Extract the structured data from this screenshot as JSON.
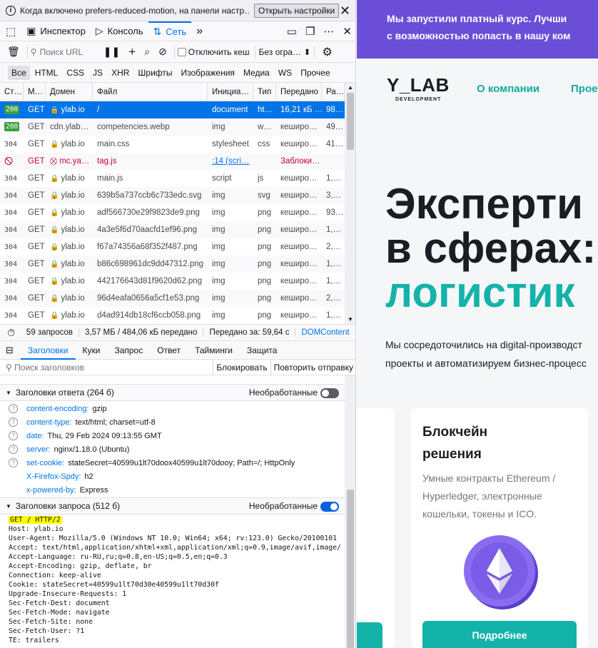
{
  "notification": {
    "text": "Когда включено prefers-reduced-motion, на панели настр…",
    "button": "Открыть настройки"
  },
  "toolbox": {
    "tabs": [
      {
        "label": "Инспектор",
        "icon": "inspector-icon"
      },
      {
        "label": "Консоль",
        "icon": "console-icon"
      },
      {
        "label": "Сеть",
        "icon": "network-icon"
      }
    ]
  },
  "network_toolbar": {
    "filter_placeholder": "Поиск URL",
    "disable_cache": "Отключить кеш",
    "throttle": "Без огра…"
  },
  "filter_types": [
    "Все",
    "HTML",
    "CSS",
    "JS",
    "XHR",
    "Шрифты",
    "Изображения",
    "Медиа",
    "WS",
    "Прочее"
  ],
  "columns": [
    "Ст…",
    "М…",
    "Домен",
    "Файл",
    "Инициа…",
    "Тип",
    "Передано",
    "Ра…"
  ],
  "requests": [
    {
      "status": "200",
      "method": "GET",
      "domain": "ylab.io",
      "file": "/",
      "initiator": "document",
      "type": "ht…",
      "transferred": "16,21 кБ …",
      "size": "98…"
    },
    {
      "status": "200",
      "method": "GET",
      "domain": "cdn.ylab…",
      "file": "competencies.webp",
      "initiator": "img",
      "type": "w…",
      "transferred": "кеширо…",
      "size": "49…"
    },
    {
      "status": "304",
      "method": "GET",
      "domain": "ylab.io",
      "file": "main.css",
      "initiator": "stylesheet",
      "type": "css",
      "transferred": "кеширо…",
      "size": "41…"
    },
    {
      "status": "blocked",
      "method": "GET",
      "domain": "mc.ya…",
      "file": "tag.js",
      "initiator": ":14 (scri…",
      "type": "",
      "transferred": "Заблоки…",
      "size": ""
    },
    {
      "status": "304",
      "method": "GET",
      "domain": "ylab.io",
      "file": "main.js",
      "initiator": "script",
      "type": "js",
      "transferred": "кеширо…",
      "size": "1,…"
    },
    {
      "status": "304",
      "method": "GET",
      "domain": "ylab.io",
      "file": "639b5a737ccb6c733edc.svg",
      "initiator": "img",
      "type": "svg",
      "transferred": "кеширо…",
      "size": "3,…"
    },
    {
      "status": "304",
      "method": "GET",
      "domain": "ylab.io",
      "file": "adf566730e29f9823de9.png",
      "initiator": "img",
      "type": "png",
      "transferred": "кеширо…",
      "size": "93…"
    },
    {
      "status": "304",
      "method": "GET",
      "domain": "ylab.io",
      "file": "4a3e5f6d70aacfd1ef96.png",
      "initiator": "img",
      "type": "png",
      "transferred": "кеширо…",
      "size": "1,…"
    },
    {
      "status": "304",
      "method": "GET",
      "domain": "ylab.io",
      "file": "f67a74356a68f352f487.png",
      "initiator": "img",
      "type": "png",
      "transferred": "кеширо…",
      "size": "2,…"
    },
    {
      "status": "304",
      "method": "GET",
      "domain": "ylab.io",
      "file": "b86c698961dc9dd47312.png",
      "initiator": "img",
      "type": "png",
      "transferred": "кеширо…",
      "size": "1,…"
    },
    {
      "status": "304",
      "method": "GET",
      "domain": "ylab.io",
      "file": "442176643d81f9620d62.png",
      "initiator": "img",
      "type": "png",
      "transferred": "кеширо…",
      "size": "1,…"
    },
    {
      "status": "304",
      "method": "GET",
      "domain": "ylab.io",
      "file": "96d4eafa0656a5cf1e53.png",
      "initiator": "img",
      "type": "png",
      "transferred": "кеширо…",
      "size": "2,…"
    },
    {
      "status": "304",
      "method": "GET",
      "domain": "ylab.io",
      "file": "d4ad914db18cf6ccb058.png",
      "initiator": "img",
      "type": "png",
      "transferred": "кеширо…",
      "size": "1,…"
    }
  ],
  "summary": {
    "requests": "59 запросов",
    "transferred": "3,57 МБ / 484,06 кБ передано",
    "time": "Передано за: 59,64 с",
    "dom": "DOMContent"
  },
  "details": {
    "tabs": [
      "Заголовки",
      "Куки",
      "Запрос",
      "Ответ",
      "Тайминги",
      "Защита"
    ],
    "filter_placeholder": "Поиск заголовков",
    "block": "Блокировать",
    "resend": "Повторить отправку",
    "raw_label": "Необработанные",
    "response_title": "Заголовки ответа (264 б)",
    "response_headers": [
      {
        "name": "content-encoding:",
        "value": "gzip"
      },
      {
        "name": "content-type:",
        "value": "text/html; charset=utf-8"
      },
      {
        "name": "date:",
        "value": "Thu, 29 Feb 2024 09:13:55 GMT"
      },
      {
        "name": "server:",
        "value": "nginx/1.18.0 (Ubuntu)"
      },
      {
        "name": "set-cookie:",
        "value": "stateSecret=40599u1lt70doox40599u1lt70dooy; Path=/; HttpOnly"
      },
      {
        "name": "X-Firefox-Spdy:",
        "value": "h2"
      },
      {
        "name": "x-powered-by:",
        "value": "Express"
      }
    ],
    "request_title": "Заголовки запроса (512 б)",
    "request_first_line": "GET / HTTP/2",
    "request_raw": "Host: ylab.io\nUser-Agent: Mozilla/5.0 (Windows NT 10.0; Win64; x64; rv:123.0) Gecko/20100101\nAccept: text/html,application/xhtml+xml,application/xml;q=0.9,image/avif,image/\nAccept-Language: ru-RU,ru;q=0.8,en-US;q=0.5,en;q=0.3\nAccept-Encoding: gzip, deflate, br\nConnection: keep-alive\nCookie: stateSecret=40599u1lt70d30e40599u1lt70d30f\nUpgrade-Insecure-Requests: 1\nSec-Fetch-Dest: document\nSec-Fetch-Mode: navigate\nSec-Fetch-Site: none\nSec-Fetch-User: ?1\nTE: trailers"
  },
  "page": {
    "banner_line1": "Мы запустили платный курс. Лучши",
    "banner_line2": "с возможностью попасть в нашу ком",
    "logo": "Y_LAB",
    "logo_sub": "DEVELOPMENT",
    "nav": [
      "О компании",
      "Прое"
    ],
    "hero1": "Эксперти",
    "hero2": "в сферах:",
    "hero3": "логистик",
    "lead1": "Мы сосредоточились на digital-производст",
    "lead2": "проекты и автоматизируем бизнес-процесс",
    "card_title1": "Блокчейн",
    "card_title2": "решения",
    "card_desc": "Умные контракты Ethereum / Hyperledger, электронные кошельки, токены и ICO.",
    "card_button": "Подробнее"
  },
  "colors": {
    "accent": "#0074e8",
    "status_ok": "#3b9e3f",
    "brand_teal": "#14b3a9",
    "banner": "#6a4ed8"
  }
}
